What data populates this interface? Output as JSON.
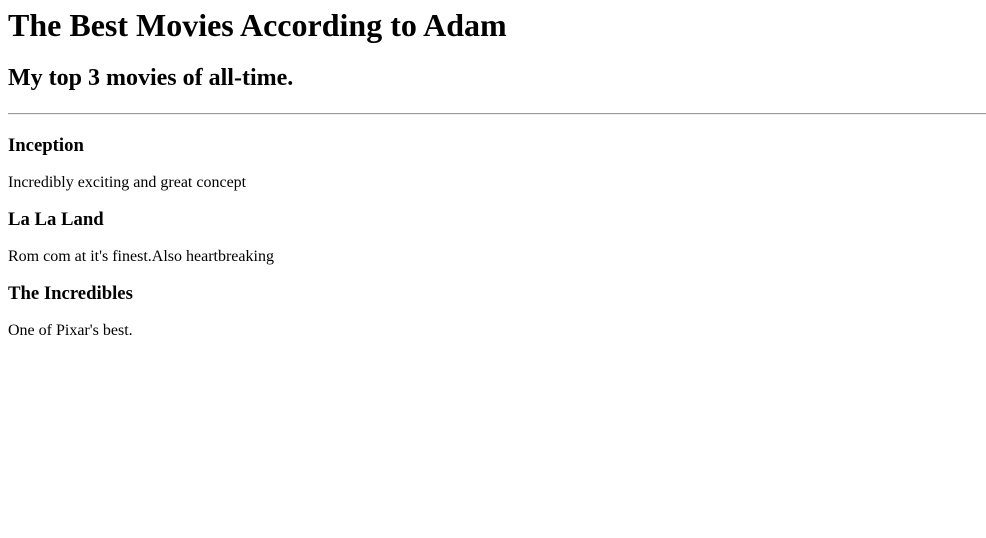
{
  "page": {
    "title": "The Best Movies According to Adam",
    "subtitle": "My top 3 movies of all-time."
  },
  "movies": [
    {
      "title": "Inception",
      "description": "Incredibly exciting and great concept"
    },
    {
      "title": "La La Land",
      "description": "Rom com at it's finest.Also heartbreaking"
    },
    {
      "title": "The Incredibles",
      "description": "One of Pixar's best."
    }
  ]
}
